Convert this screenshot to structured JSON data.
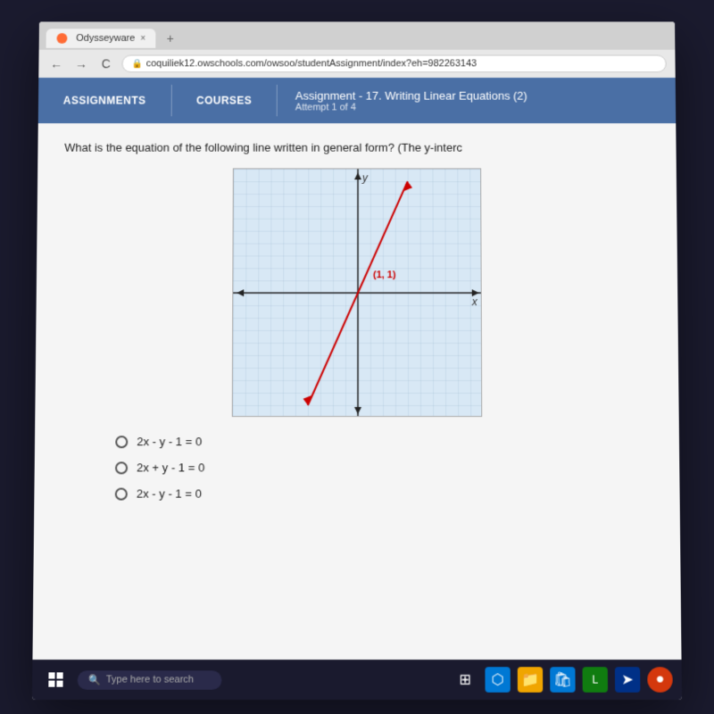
{
  "browser": {
    "tab_title": "Odysseyware",
    "tab_close": "×",
    "new_tab": "+",
    "nav_back": "←",
    "nav_forward": "→",
    "nav_refresh": "C",
    "url": "coquiliek12.owschools.com/owsoo/studentAssignment/index?eh=982263143",
    "lock_symbol": "🔒"
  },
  "header": {
    "assignments_label": "ASSIGNMENTS",
    "courses_label": "COURSES",
    "assignment_prefix": "Assignment",
    "assignment_title": " - 17. Writing Linear Equations (2)",
    "attempt_label": "Attempt 1 of 4"
  },
  "question": {
    "text": "What is the equation of the following line written in general form? (The y-interc",
    "graph": {
      "y_label": "y",
      "x_label": "x",
      "point_label": "(1, 1)"
    },
    "choices": [
      {
        "id": "a",
        "text": "2x - y - 1 = 0",
        "selected": false
      },
      {
        "id": "b",
        "text": "2x + y - 1 = 0",
        "selected": false
      },
      {
        "id": "c",
        "text": "2x - y - 1 = 0",
        "selected": false
      }
    ]
  },
  "taskbar": {
    "search_placeholder": "Type here to search"
  }
}
